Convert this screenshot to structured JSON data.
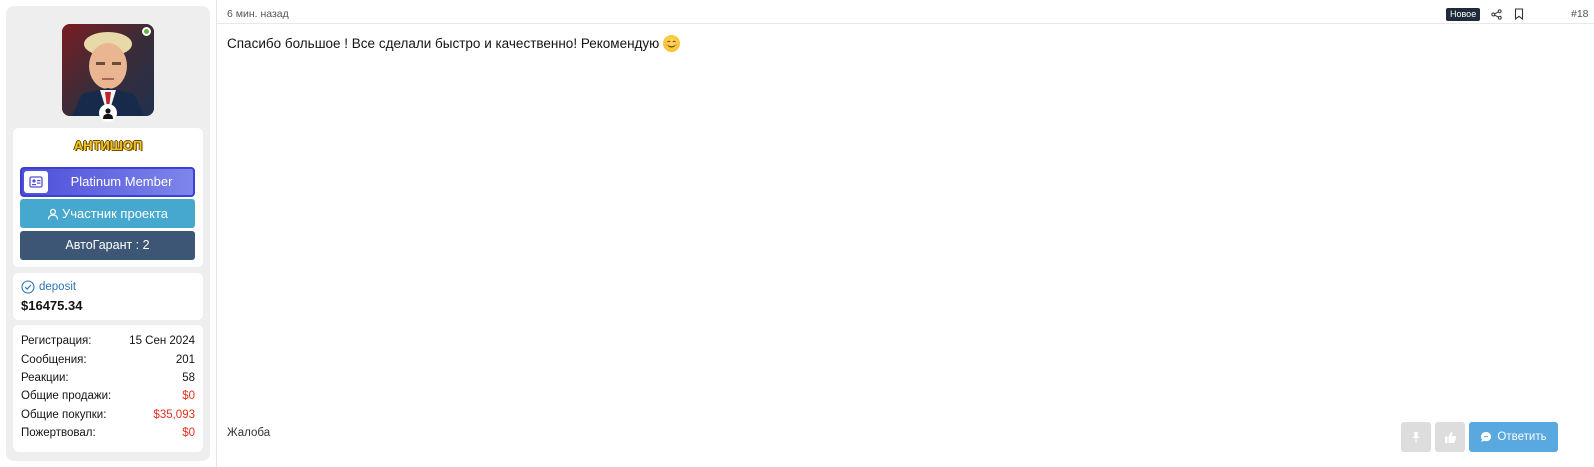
{
  "user": {
    "username": "АНТИШОП",
    "badge_title": "Platinum Member",
    "role": "Участник проекта",
    "guarantee": "АвтоГарант : 2"
  },
  "deposit": {
    "label": "deposit",
    "amount": "$16475.34"
  },
  "stats": [
    {
      "label": "Регистрация:",
      "value": "15 Сен 2024",
      "color": "#141414"
    },
    {
      "label": "Сообщения:",
      "value": "201",
      "color": "#141414"
    },
    {
      "label": "Реакции:",
      "value": "58",
      "color": "#141414"
    },
    {
      "label": "Общие продажи:",
      "value": "$0",
      "color": "#e0301e"
    },
    {
      "label": "Общие покупки:",
      "value": "$35,093",
      "color": "#e0301e"
    },
    {
      "label": "Пожертвовал:",
      "value": "$0",
      "color": "#e0301e"
    }
  ],
  "post": {
    "timestamp": "6 мин. назад",
    "new_badge": "Новое",
    "number": "#18",
    "message": "Спасибо большое ! Все сделали быстро и качественно! Рекомендую",
    "complaint": "Жалоба",
    "reply_label": "Ответить"
  },
  "icons": {
    "share": "share-icon",
    "bookmark": "bookmark-icon",
    "pin": "pin-icon",
    "like": "thumbs-up-icon",
    "reply": "chat-bubble-icon"
  },
  "colors": {
    "platinum": "#4d4fd9",
    "member": "#46a7cf",
    "guarantee": "#3e5675",
    "reply": "#59a8df",
    "negative": "#e0301e",
    "username": "#f2c324"
  }
}
